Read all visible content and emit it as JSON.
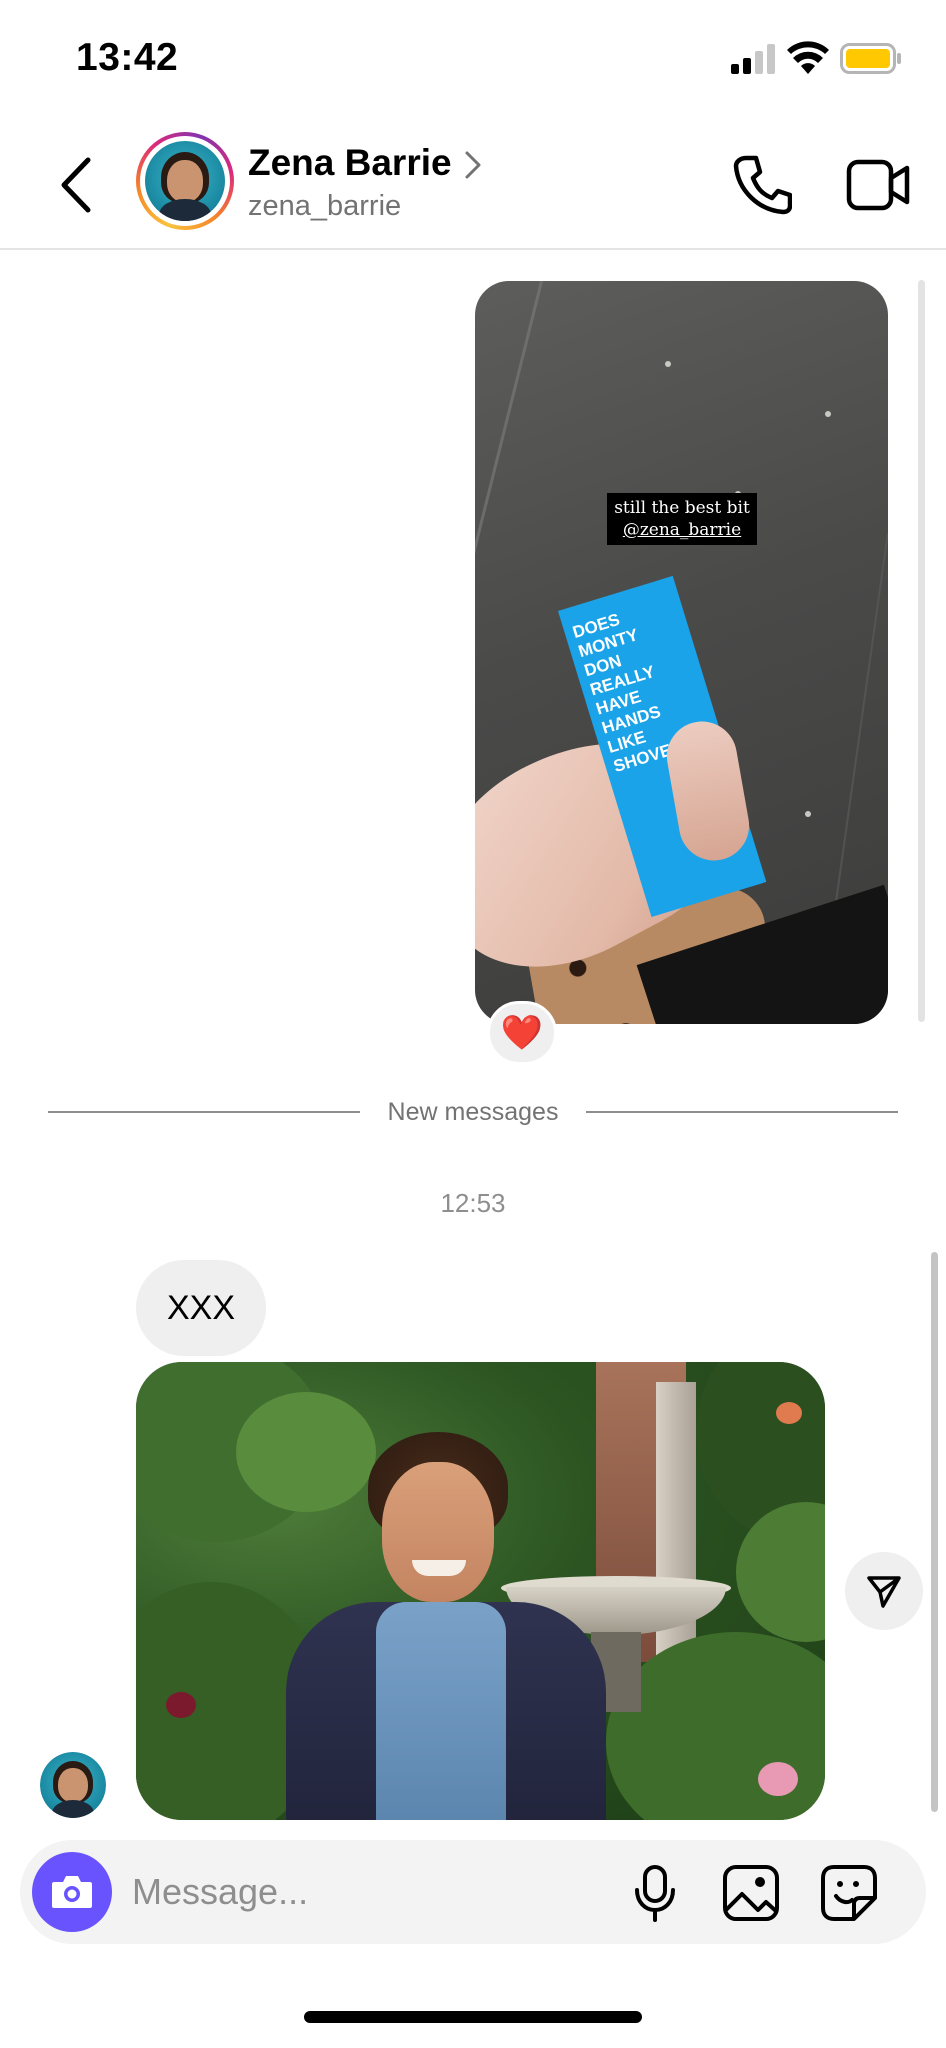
{
  "status_bar": {
    "time": "13:42",
    "signal_icon": "cellular-signal-icon",
    "wifi_icon": "wifi-icon",
    "battery_icon": "battery-low-power-icon",
    "battery_color": "#ffc800"
  },
  "header": {
    "back_icon": "chevron-left-icon",
    "contact_name": "Zena Barrie",
    "contact_handle": "zena_barrie",
    "name_chevron_icon": "chevron-right-icon",
    "call_icon": "phone-icon",
    "video_icon": "video-camera-icon",
    "story_ring_colors": [
      "#f9c23c",
      "#f58529",
      "#dd2a7b",
      "#8134af"
    ]
  },
  "shared_story": {
    "caption_line1": "still the best bit",
    "caption_mention": "@zena_barrie",
    "card_text": "DOES\nMONTY\nDON\nREALLY\nHAVE\nHANDS\nLIKE\nSHOVELS?",
    "card_color": "#1aa3e8",
    "reaction": "❤️"
  },
  "divider": {
    "label": "New messages"
  },
  "conversation": {
    "timestamp": "12:53",
    "messages": [
      {
        "type": "text",
        "text": "XXX"
      },
      {
        "type": "photo",
        "subject": "man smiling in a garden with a fountain"
      }
    ],
    "share_icon": "send-paper-plane-icon"
  },
  "composer": {
    "camera_icon": "camera-icon",
    "camera_color": "#6853ff",
    "placeholder": "Message...",
    "value": "",
    "mic_icon": "microphone-icon",
    "gallery_icon": "image-gallery-icon",
    "sticker_icon": "sticker-icon"
  }
}
